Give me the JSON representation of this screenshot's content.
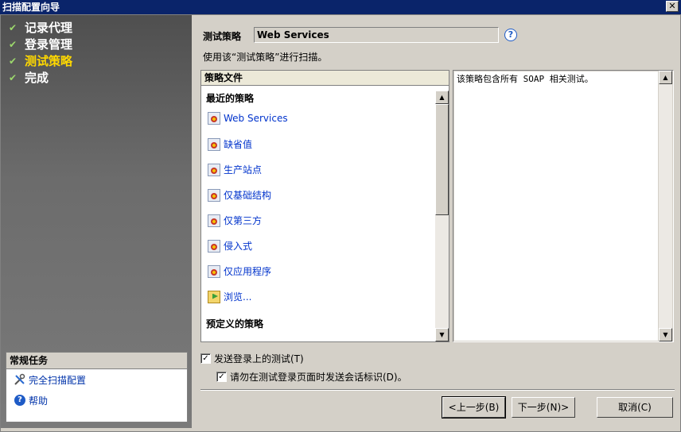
{
  "window": {
    "title": "扫描配置向导",
    "close_label": "✕"
  },
  "steps": [
    {
      "label": "记录代理",
      "state": "done"
    },
    {
      "label": "登录管理",
      "state": "done"
    },
    {
      "label": "测试策略",
      "state": "active"
    },
    {
      "label": "完成",
      "state": "done"
    }
  ],
  "tasks": {
    "header": "常规任务",
    "items": [
      {
        "label": "完全扫描配置",
        "icon": "tools-icon"
      },
      {
        "label": "帮助",
        "icon": "help-icon"
      }
    ]
  },
  "policy": {
    "label": "测试策略",
    "value": "Web Services",
    "instruction": "使用该“测试策略”进行扫描。",
    "help_icon": "?"
  },
  "policy_files": {
    "header": "策略文件",
    "recent_header": "最近的策略",
    "recent": [
      "Web Services",
      "缺省值",
      "生产站点",
      "仅基础结构",
      "仅第三方",
      "侵入式",
      "仅应用程序"
    ],
    "browse": "浏览...",
    "predefined_header": "预定义的策略"
  },
  "description": "该策略包含所有 SOAP 相关测试。",
  "options": {
    "send_login_tests": {
      "label": "发送登录上的测试(T)",
      "checked": true
    },
    "no_session_ids": {
      "label": "请勿在测试登录页面时发送会话标识(D)。",
      "checked": true
    }
  },
  "buttons": {
    "back": "<上一步(B)",
    "next": "下一步(N)>",
    "cancel": "取消(C)"
  },
  "colors": {
    "title_bar": "#0a246a",
    "active_step": "#ffd800",
    "link": "#0033cc"
  }
}
